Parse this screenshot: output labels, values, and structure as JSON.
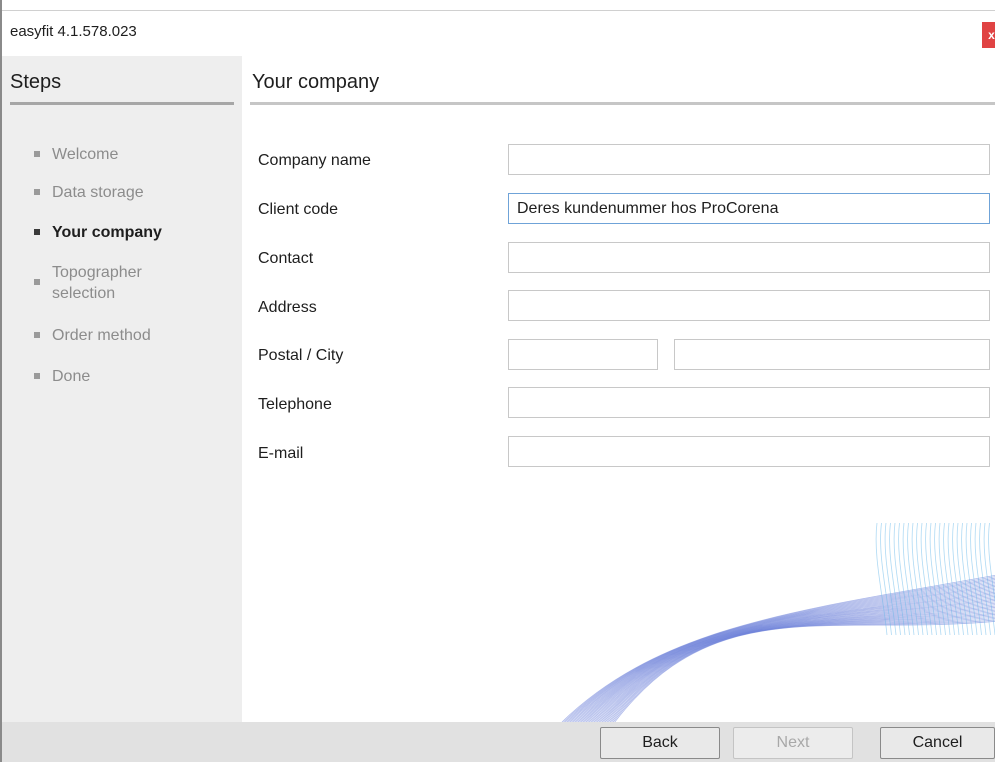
{
  "window": {
    "title": "easyfit 4.1.578.023",
    "close_glyph": "x"
  },
  "sidebar": {
    "header": "Steps",
    "steps": [
      {
        "label": "Welcome",
        "active": false
      },
      {
        "label": "Data storage",
        "active": false
      },
      {
        "label": "Your company",
        "active": true
      },
      {
        "label": "Topographer selection",
        "active": false
      },
      {
        "label": "Order method",
        "active": false
      },
      {
        "label": "Done",
        "active": false
      }
    ]
  },
  "main": {
    "header": "Your company",
    "fields": {
      "company_name": {
        "label": "Company name",
        "value": ""
      },
      "client_code": {
        "label": "Client code",
        "value": "Deres kundenummer hos ProCorena"
      },
      "contact": {
        "label": "Contact",
        "value": ""
      },
      "address": {
        "label": "Address",
        "value": ""
      },
      "postal_city": {
        "label": "Postal / City",
        "postal_value": "",
        "city_value": ""
      },
      "telephone": {
        "label": "Telephone",
        "value": ""
      },
      "email": {
        "label": "E-mail",
        "value": ""
      }
    }
  },
  "footer": {
    "back_label": "Back",
    "next_label": "Next",
    "cancel_label": "Cancel",
    "next_enabled": false
  },
  "colors": {
    "sidebar_bg": "#eeeeee",
    "close_button": "#e04343",
    "focus_border": "#6fa3d8",
    "decor_wave": "#6b7fd8"
  }
}
